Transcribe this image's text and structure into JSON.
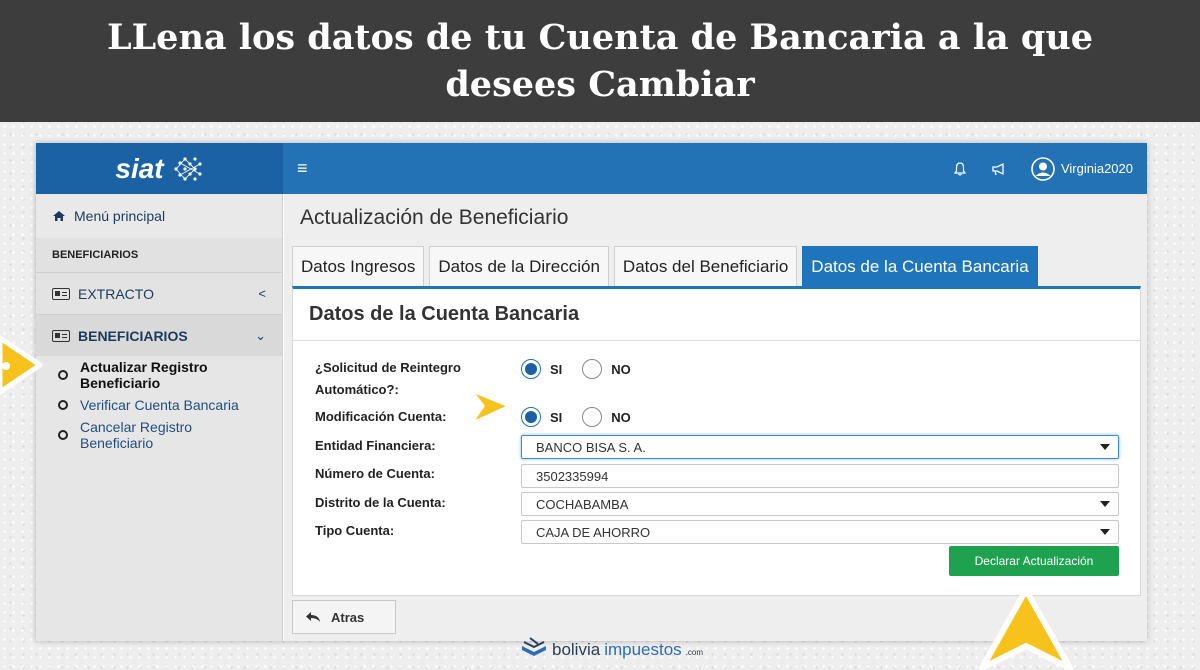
{
  "banner": {
    "title": "LLena los datos de tu Cuenta de Bancaria a la que desees Cambiar"
  },
  "app": {
    "brand": "siat",
    "user": "Virginia2020"
  },
  "sidebar": {
    "menu_label": "Menú principal",
    "section_label": "BENEFICIARIOS",
    "groups": [
      {
        "label": "EXTRACTO",
        "chevron": "<"
      },
      {
        "label": "BENEFICIARIOS",
        "chevron": "⌄"
      }
    ],
    "items": [
      {
        "label": "Actualizar Registro Beneficiario"
      },
      {
        "label": "Verificar Cuenta Bancaria"
      },
      {
        "label": "Cancelar Registro Beneficiario"
      }
    ]
  },
  "main": {
    "page_title": "Actualización de Beneficiario",
    "tabs": [
      {
        "label": "Datos Ingresos"
      },
      {
        "label": "Datos de la Dirección"
      },
      {
        "label": "Datos del Beneficiario"
      },
      {
        "label": "Datos de la Cuenta Bancaria"
      }
    ],
    "panel_title": "Datos de la Cuenta Bancaria",
    "form": {
      "reintegro_label_1": "¿Solicitud de Reintegro",
      "reintegro_label_2": "Automático?:",
      "modificacion_label": "Modificación Cuenta:",
      "entidad_label": "Entidad Financiera:",
      "numero_label": "Número de Cuenta:",
      "distrito_label": "Distrito de la Cuenta:",
      "tipo_label": "Tipo Cuenta:",
      "yes": "SI",
      "no": "NO",
      "reintegro_value": "SI",
      "modificacion_value": "SI",
      "entidad_value": "BANCO BISA S. A.",
      "numero_value": "3502335994",
      "distrito_value": "COCHABAMBA",
      "tipo_value": "CAJA DE AHORRO"
    },
    "declare_button": "Declarar Actualización",
    "back_button": "Atras"
  },
  "footer": {
    "logo_part1": "bolivia",
    "logo_part2": "impuestos",
    "logo_part3": ".com"
  },
  "colors": {
    "banner_bg": "#3d3d3d",
    "brand_blue": "#1a62a3",
    "accent_blue": "#1f75bc",
    "green": "#1ea24f",
    "arrow_yellow": "#f6c21b"
  }
}
